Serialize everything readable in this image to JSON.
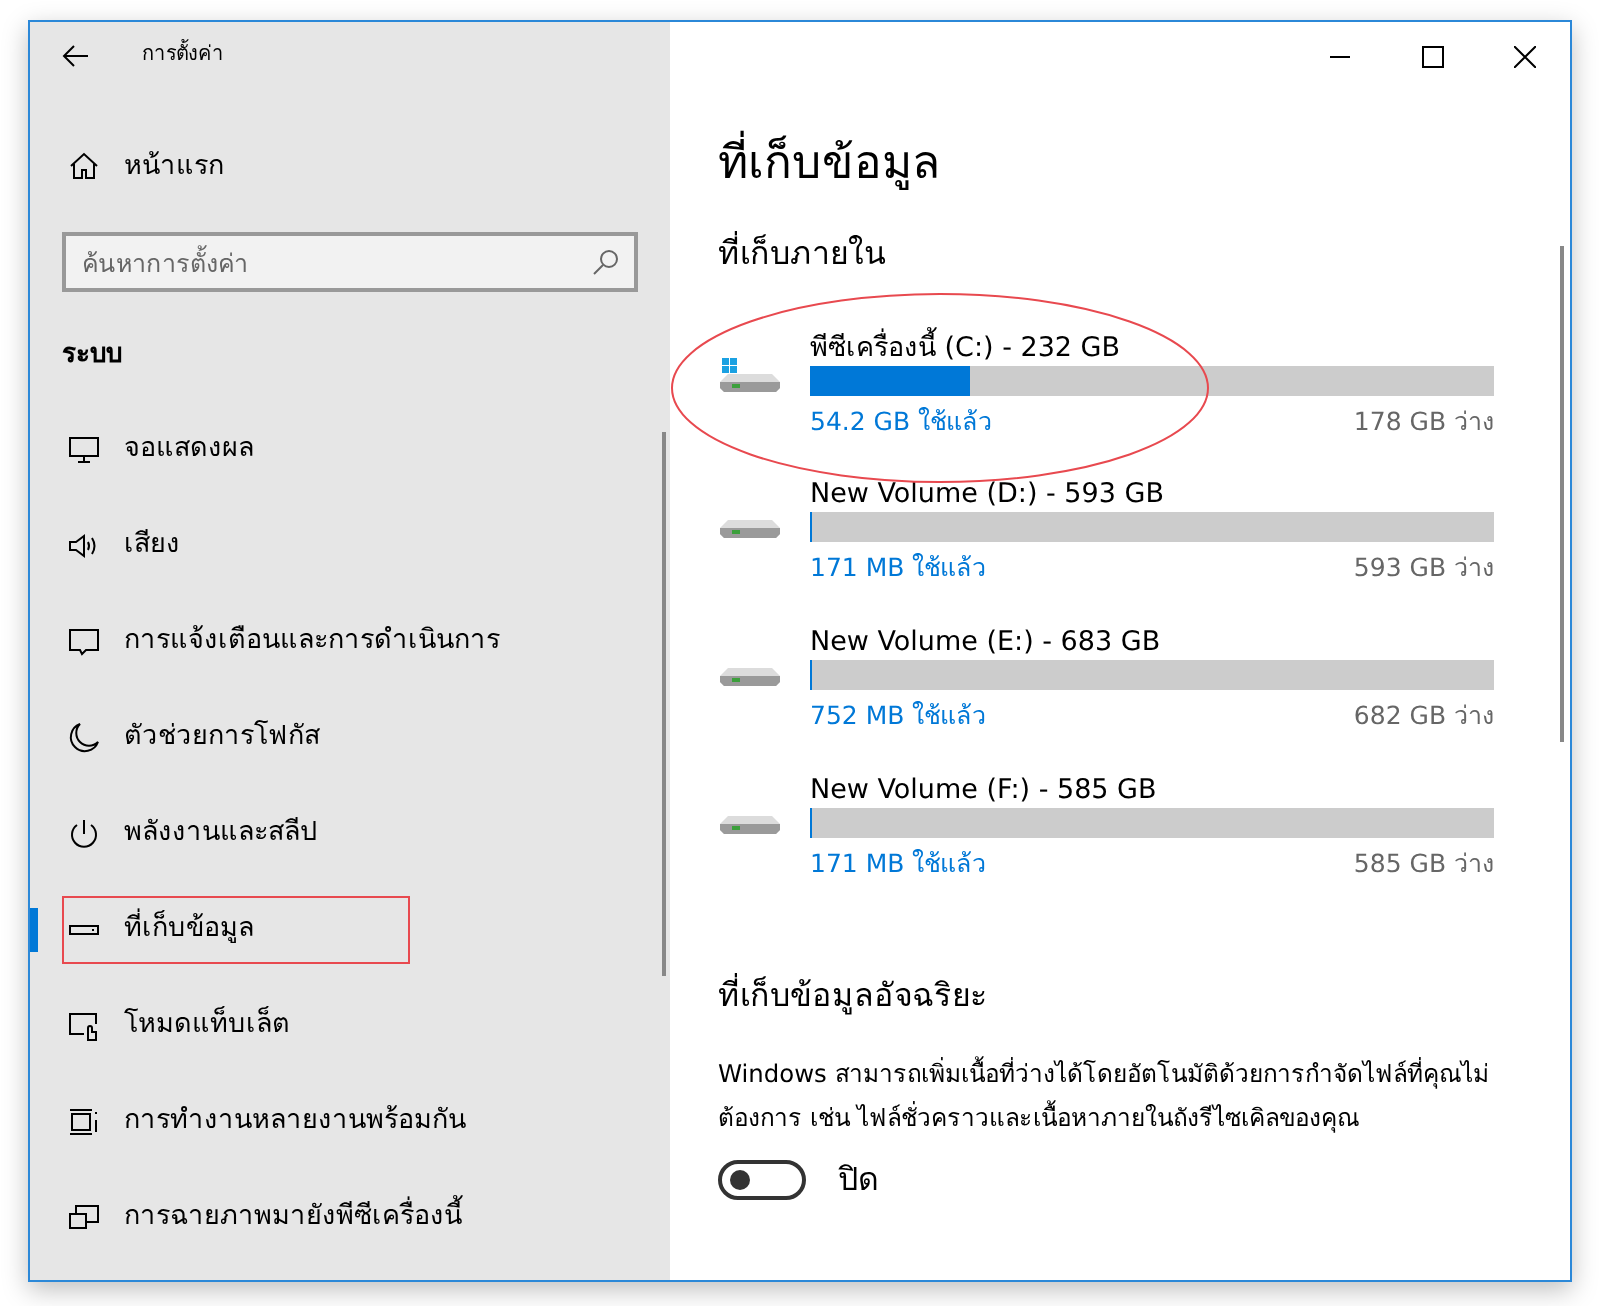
{
  "window": {
    "title": "การตั้งค่า"
  },
  "sidebar": {
    "home": "หน้าแรก",
    "search": {
      "placeholder": "ค้นหาการตั้งค่า"
    },
    "section": "ระบบ",
    "items": [
      {
        "label": "จอแสดงผล",
        "kind": "display",
        "selected": false
      },
      {
        "label": "เสียง",
        "kind": "sound",
        "selected": false
      },
      {
        "label": "การแจ้งเตือนและการดำเนินการ",
        "kind": "notify",
        "selected": false
      },
      {
        "label": "ตัวช่วยการโฟกัส",
        "kind": "moon",
        "selected": false
      },
      {
        "label": "พลังงานและสลีป",
        "kind": "power",
        "selected": false
      },
      {
        "label": "ที่เก็บข้อมูล",
        "kind": "storage",
        "selected": true
      },
      {
        "label": "โหมดแท็บเล็ต",
        "kind": "tablet",
        "selected": false
      },
      {
        "label": "การทำงานหลายงานพร้อมกัน",
        "kind": "multitask",
        "selected": false
      },
      {
        "label": "การฉายภาพมายังพีซีเครื่องนี้",
        "kind": "project",
        "selected": false
      }
    ]
  },
  "main": {
    "title": "ที่เก็บข้อมูล",
    "internal_heading": "ที่เก็บภายใน",
    "drives": [
      {
        "name": "พีซีเครื่องนี้ (C:) - 232 GB",
        "kind": "system",
        "level": 0.234,
        "used": "54.2 GB ใช้แล้ว",
        "free": "178 GB ว่าง"
      },
      {
        "name": "New Volume (D:) - 593 GB",
        "kind": "volume",
        "level": 0.0003,
        "used": "171 MB ใช้แล้ว",
        "free": "593 GB ว่าง"
      },
      {
        "name": "New Volume (E:) - 683 GB",
        "kind": "volume",
        "level": 0.0011,
        "used": "752 MB ใช้แล้ว",
        "free": "682 GB ว่าง"
      },
      {
        "name": "New Volume (F:) - 585 GB",
        "kind": "volume",
        "level": 0.0003,
        "used": "171 MB ใช้แล้ว",
        "free": "585 GB ว่าง"
      }
    ],
    "sense": {
      "title": "ที่เก็บข้อมูลอัจฉริยะ",
      "description": "Windows สามารถเพิ่มเนื้อที่ว่างได้โดยอัตโนมัติด้วยการกำจัดไฟล์ที่คุณไม่ต้องการ เช่น ไฟล์ชั่วคราวและเนื้อหาภายในถังรีไซเคิลของคุณ",
      "toggle": {
        "on": false,
        "label": "ปิด"
      }
    }
  }
}
